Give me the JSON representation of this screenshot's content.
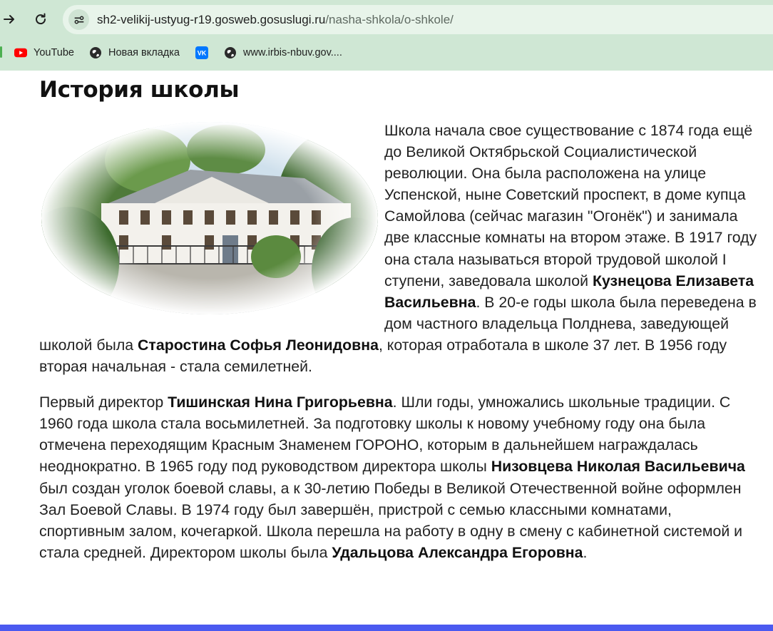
{
  "browser": {
    "url_host": "sh2-velikij-ustyug-r19.gosweb.gosuslugi.ru",
    "url_path": "/nasha-shkola/o-shkole/",
    "bookmarks": [
      {
        "label": "YouTube",
        "icon": "youtube-icon"
      },
      {
        "label": "Новая вкладка",
        "icon": "globe-icon"
      },
      {
        "label": "",
        "icon": "vk-icon"
      },
      {
        "label": "www.irbis-nbuv.gov....",
        "icon": "globe-icon"
      }
    ]
  },
  "page": {
    "title": "История школы",
    "photo_alt": "school-building-photo",
    "p1": [
      "Школа начала свое существование с 1874 года ещё до Великой Октябрьской Социалистической революции. Она была расположена на улице Успенской, ныне Советский проспект, в доме купца Самойлова (сейчас магазин \"Огонёк\") и занимала две классные комнаты на втором этаже. В 1917 году она стала называться второй трудовой школой I ступени, заведовала школой ",
      "Кузнецова Елизавета Васильевна",
      ". В 20-е годы школа была переведена в дом частного владельца Полднева, заведующей школой была ",
      "Старостина Софья Леонидовна",
      ", которая отработала в школе 37 лет. В 1956 году вторая начальная - стала семилетней."
    ],
    "p2": [
      "Первый директор ",
      "Тишинская Нина Григорьевна",
      ". Шли годы, умножались школьные традиции. С 1960 года школа стала восьмилетней. За подготовку школы к новому учебному году она была отмечена переходящим Красным Знаменем ГОРОНО, которым в дальнейшем награждалась неоднократно. В 1965 году под руководством директора школы ",
      "Низовцева Николая Васильевича",
      " был создан уголок боевой славы, а к 30-летию Победы в Великой Отечественной войне оформлен Зал Боевой Славы. В 1974 году был завершён, пристрой с семью классными комнатами, спортивным залом, кочегаркой. Школа перешла на работу в одну в смену с кабинетной системой и стала средней. Директором школы была ",
      "Удальцова Александра Егоровна",
      "."
    ]
  },
  "colors": {
    "chrome_bg": "#cfe7d4",
    "omnibox_bg": "#e8f4ea",
    "bottom_bar": "#4b5af0",
    "youtube_red": "#ff0000",
    "vk_blue": "#0077ff"
  }
}
